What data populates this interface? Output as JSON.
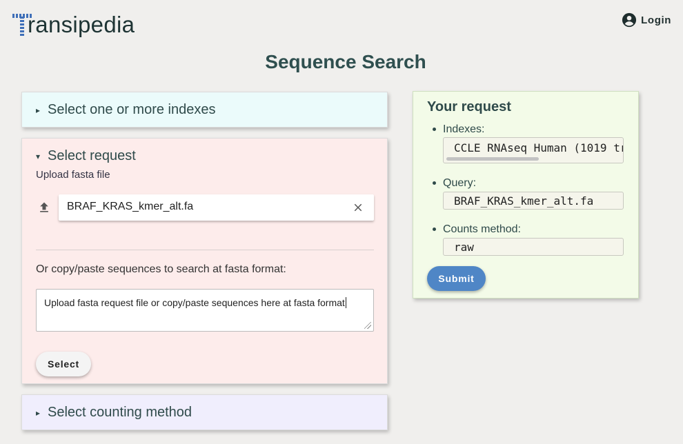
{
  "app": {
    "logo_text": "ransipedia",
    "login_label": "Login"
  },
  "page": {
    "title": "Sequence Search"
  },
  "panels": {
    "indexes": {
      "title": "Select one or more indexes",
      "caret": "▸"
    },
    "request": {
      "title": "Select request",
      "caret": "▾",
      "upload_label": "Upload fasta file",
      "file_name": "BRAF_KRAS_kmer_alt.fa",
      "paste_label": "Or copy/paste sequences to search at fasta format:",
      "paste_value": "Upload fasta request file or copy/paste sequences here at fasta format",
      "select_button": "Select"
    },
    "counting": {
      "title": "Select counting method",
      "caret": "▸"
    }
  },
  "summary": {
    "title": "Your request",
    "indexes_label": "Indexes:",
    "indexes_value": "CCLE RNAseq Human (1019 tr",
    "query_label": "Query:",
    "query_value": "BRAF_KRAS_kmer_alt.fa",
    "counts_label": "Counts method:",
    "counts_value": "raw",
    "submit_button": "Submit"
  },
  "icons": {
    "user": "account-circle-icon",
    "upload": "upload-icon",
    "clear": "close-icon"
  },
  "colors": {
    "background": "#f0efed",
    "indexes_panel": "#ebfbfb",
    "request_panel": "#fdeceb",
    "counting_panel": "#f0eefd",
    "summary_panel": "#f3fbe8",
    "submit_button": "#4f86c6",
    "logo_accent": "#3f6fb8"
  }
}
